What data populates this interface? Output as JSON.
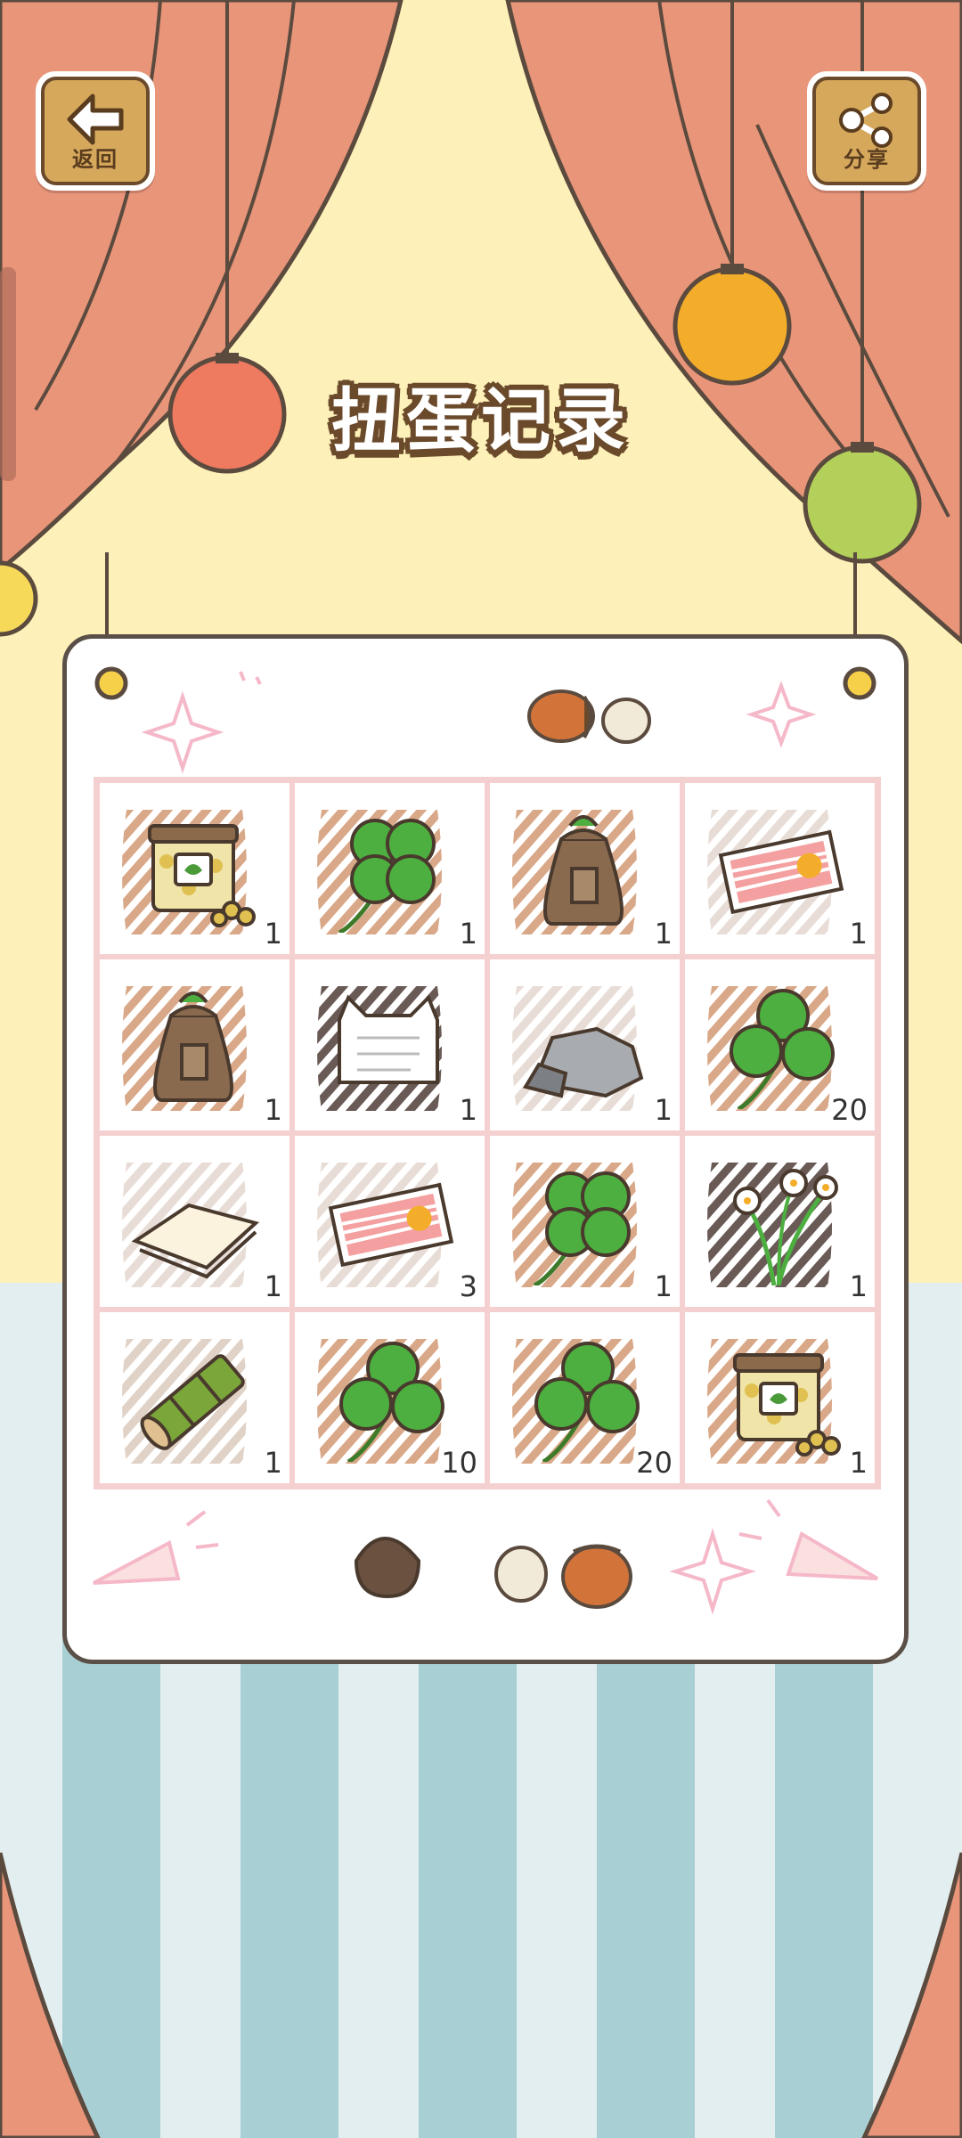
{
  "header": {
    "back_label": "返回",
    "share_label": "分享",
    "title": "扭蛋记录"
  },
  "colors": {
    "curtain": "#e8957a",
    "curtain_outline": "#5b4a3e",
    "wall": "#fdf0b8",
    "floor_stripe_light": "#e2eef0",
    "floor_stripe_dark": "#a8cfd4",
    "wood": "#d6a85c",
    "grid_line": "#f5d0d0"
  },
  "records": [
    {
      "item": "rice-can-icon",
      "count": "1"
    },
    {
      "item": "four-leaf-clover-icon",
      "count": "1"
    },
    {
      "item": "seed-bag-icon",
      "count": "1"
    },
    {
      "item": "ticket-icon",
      "count": "1"
    },
    {
      "item": "seed-bag-icon",
      "count": "1"
    },
    {
      "item": "cat-note-icon",
      "count": "1"
    },
    {
      "item": "stone-icon",
      "count": "1"
    },
    {
      "item": "three-leaf-clover-icon",
      "count": "20"
    },
    {
      "item": "paper-icon",
      "count": "1"
    },
    {
      "item": "ticket-icon",
      "count": "3"
    },
    {
      "item": "four-leaf-clover-icon",
      "count": "1"
    },
    {
      "item": "narcissus-icon",
      "count": "1"
    },
    {
      "item": "bamboo-icon",
      "count": "1"
    },
    {
      "item": "three-leaf-clover-icon",
      "count": "10"
    },
    {
      "item": "three-leaf-clover-icon",
      "count": "20"
    },
    {
      "item": "rice-can-icon",
      "count": "1"
    }
  ]
}
